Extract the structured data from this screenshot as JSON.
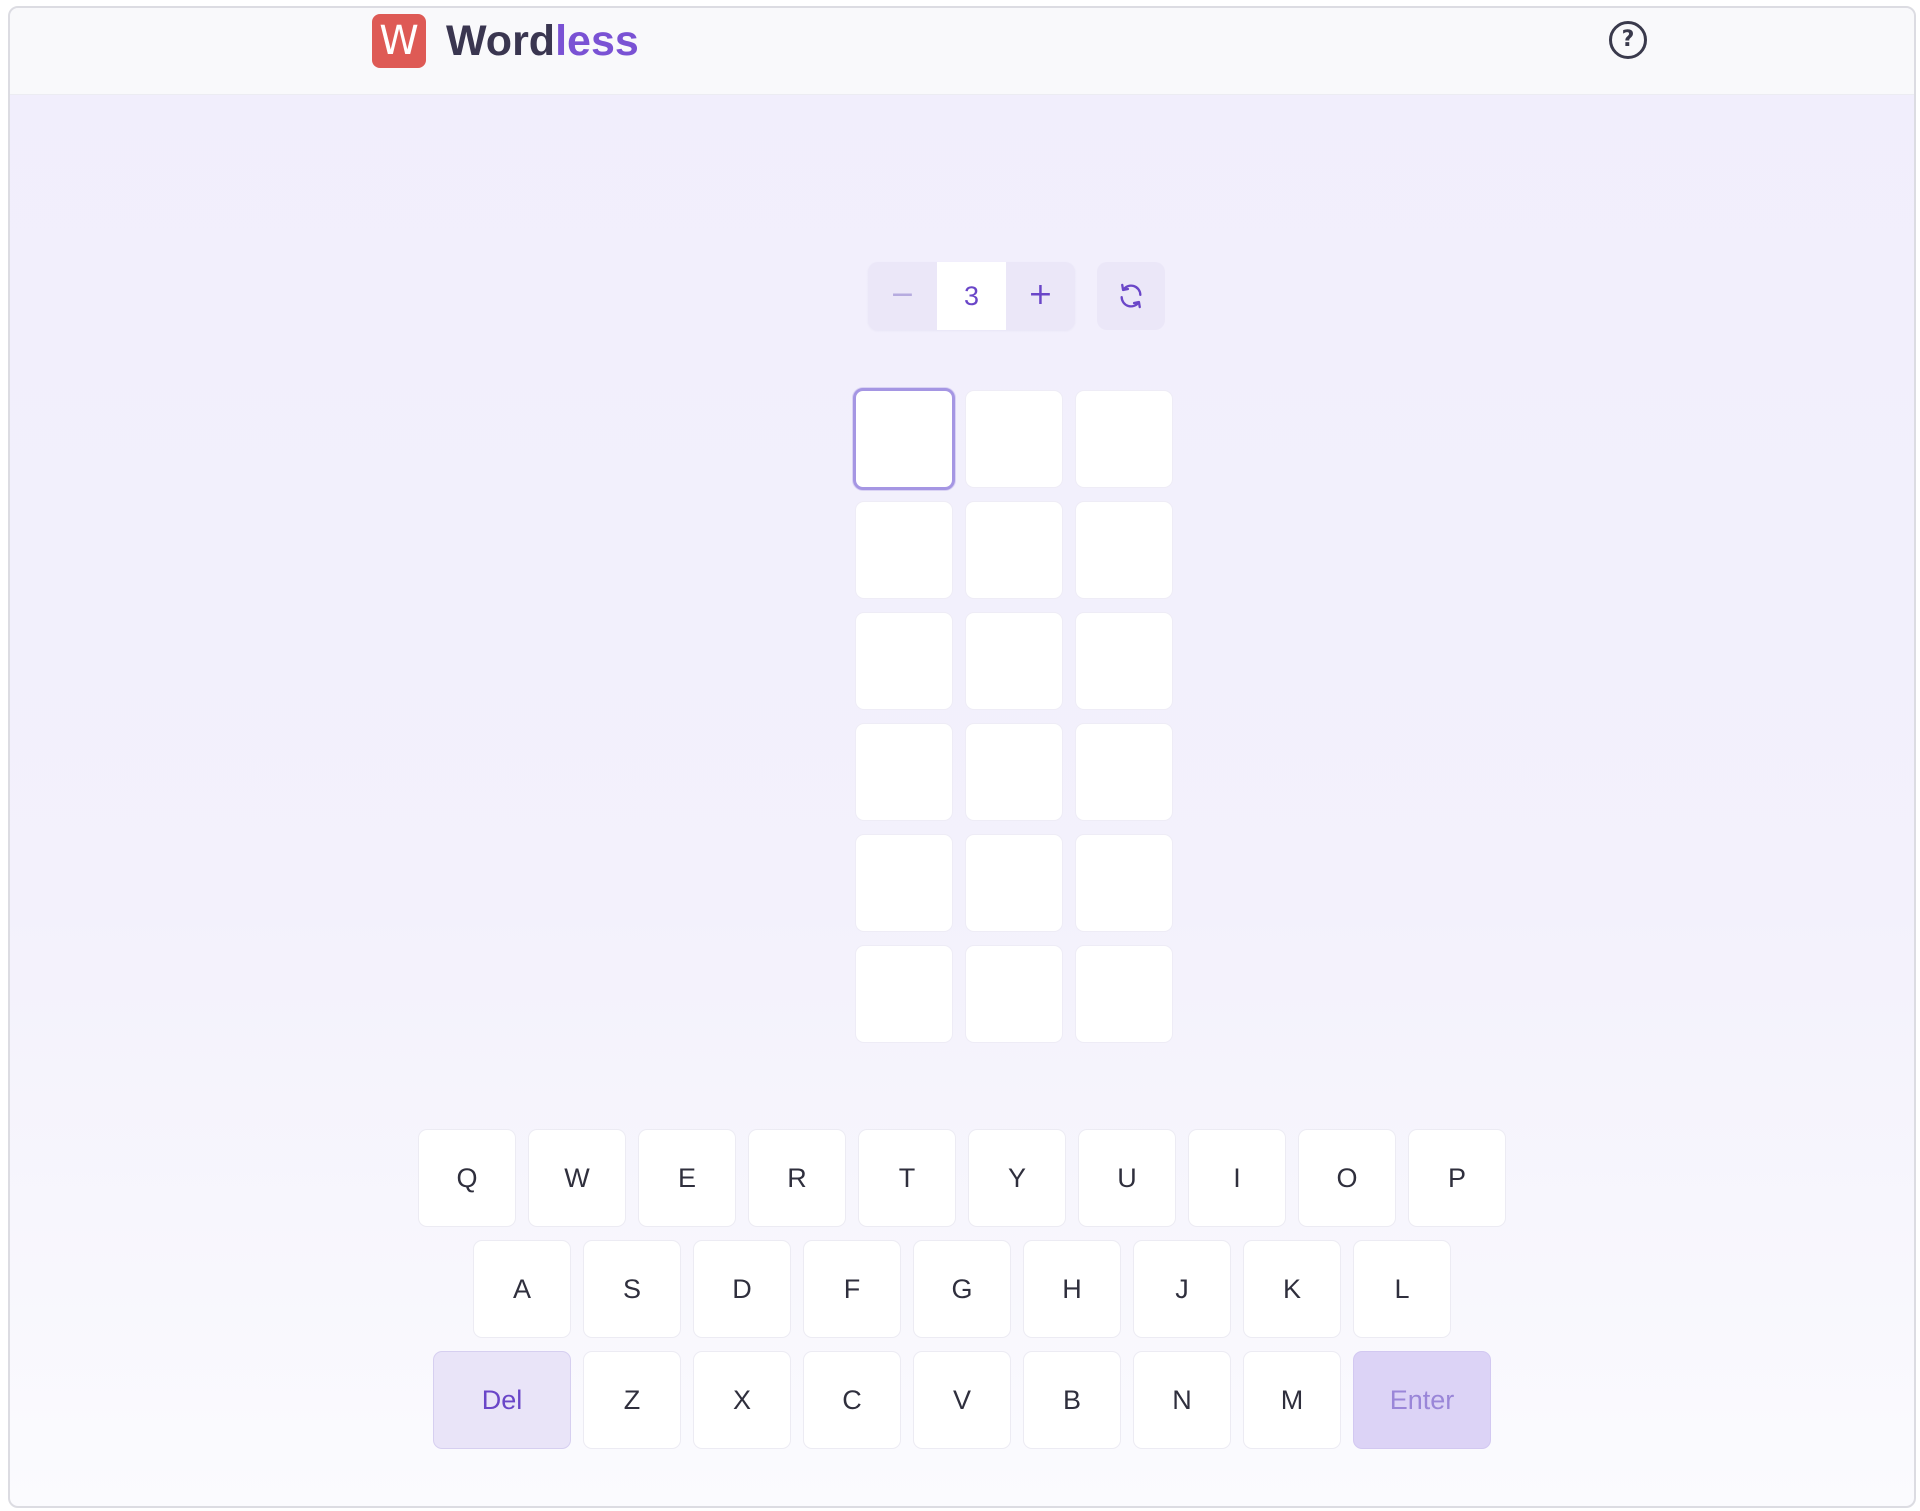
{
  "header": {
    "logo_letter": "W",
    "title_main": "Word",
    "title_accent": "less",
    "help_glyph": "?"
  },
  "controls": {
    "decrement_label": "−",
    "word_length": "3",
    "increment_label": "+",
    "refresh_icon": "refresh-icon"
  },
  "board": {
    "columns": 3,
    "rows": 6,
    "active_cell": [
      0,
      0
    ]
  },
  "keyboard": {
    "row1": [
      "Q",
      "W",
      "E",
      "R",
      "T",
      "Y",
      "U",
      "I",
      "O",
      "P"
    ],
    "row2": [
      "A",
      "S",
      "D",
      "F",
      "G",
      "H",
      "J",
      "K",
      "L"
    ],
    "row3": [
      "Z",
      "X",
      "C",
      "V",
      "B",
      "N",
      "M"
    ],
    "delete_label": "Del",
    "enter_label": "Enter"
  },
  "colors": {
    "logo_tile": "#de5a55",
    "accent": "#7a52d4",
    "button_purple": "#6a46c8",
    "active_cell_border": "#a596e3"
  }
}
